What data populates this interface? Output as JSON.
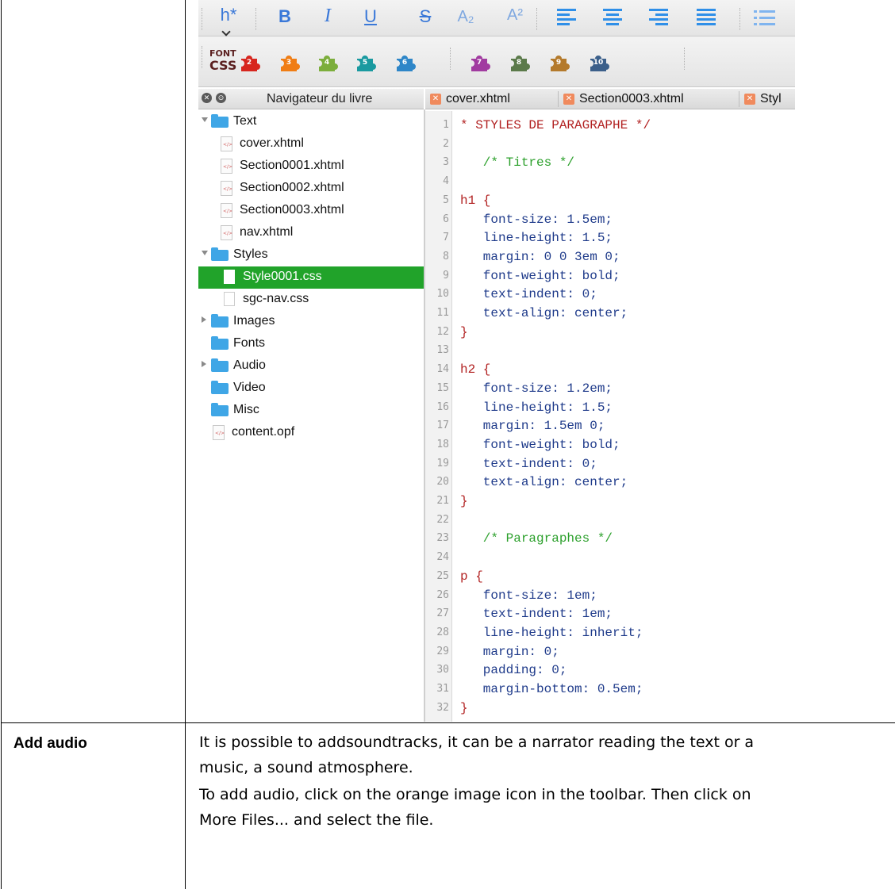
{
  "toolbar": {
    "heading_label": "h*",
    "bold": "B",
    "italic": "I",
    "underline": "U",
    "strike": "S",
    "subscript": "A₂",
    "superscript": "A²",
    "font_css_top": "FONT",
    "font_css_bottom": "CSS",
    "clip_numbers": [
      "2",
      "3",
      "4",
      "5",
      "6",
      "7",
      "8",
      "9",
      "10"
    ],
    "clip_colors": [
      "#d7261e",
      "#f07d14",
      "#7cae3c",
      "#1a9aa0",
      "#2e86c8",
      "#a13ba0",
      "#5b7a4a",
      "#b47a2c",
      "#3b5f8a"
    ]
  },
  "navigator": {
    "close_glyph": "✕",
    "float_glyph": "⊙",
    "title": "Navigateur du livre",
    "items": [
      {
        "label": "Text",
        "type": "folder",
        "expander": "down"
      },
      {
        "label": "cover.xhtml",
        "type": "file"
      },
      {
        "label": "Section0001.xhtml",
        "type": "file"
      },
      {
        "label": "Section0002.xhtml",
        "type": "file"
      },
      {
        "label": "Section0003.xhtml",
        "type": "file"
      },
      {
        "label": "nav.xhtml",
        "type": "file"
      },
      {
        "label": "Styles",
        "type": "folder",
        "expander": "down"
      },
      {
        "label": "Style0001.css",
        "type": "css",
        "selected": true
      },
      {
        "label": "sgc-nav.css",
        "type": "css"
      },
      {
        "label": "Images",
        "type": "folder",
        "expander": "right"
      },
      {
        "label": "Fonts",
        "type": "folder"
      },
      {
        "label": "Audio",
        "type": "folder",
        "expander": "right"
      },
      {
        "label": "Video",
        "type": "folder"
      },
      {
        "label": "Misc",
        "type": "folder"
      },
      {
        "label": "content.opf",
        "type": "file"
      }
    ]
  },
  "tabs": [
    {
      "label": "cover.xhtml"
    },
    {
      "label": "Section0003.xhtml"
    },
    {
      "label": "Styl"
    }
  ],
  "tab_close_glyph": "✕",
  "colors": {
    "selection": "#21a32a",
    "comment": "#2ca02c",
    "selector": "#b22222",
    "property": "#1e3a8a"
  },
  "code": {
    "lines": [
      {
        "n": "1",
        "text": "* STYLES DE PARAGRAPHE */",
        "kind": "selector"
      },
      {
        "n": "2",
        "text": "",
        "kind": "plain"
      },
      {
        "n": "3",
        "text": "   /* Titres */",
        "kind": "comment"
      },
      {
        "n": "4",
        "text": "",
        "kind": "plain"
      },
      {
        "n": "5",
        "text": "h1 {",
        "kind": "selector"
      },
      {
        "n": "6",
        "text": "   font-size: 1.5em;",
        "kind": "property"
      },
      {
        "n": "7",
        "text": "   line-height: 1.5;",
        "kind": "property"
      },
      {
        "n": "8",
        "text": "   margin: 0 0 3em 0;",
        "kind": "property"
      },
      {
        "n": "9",
        "text": "   font-weight: bold;",
        "kind": "property"
      },
      {
        "n": "10",
        "text": "   text-indent: 0;",
        "kind": "property"
      },
      {
        "n": "11",
        "text": "   text-align: center;",
        "kind": "property"
      },
      {
        "n": "12",
        "text": "}",
        "kind": "selector"
      },
      {
        "n": "13",
        "text": "",
        "kind": "plain"
      },
      {
        "n": "14",
        "text": "h2 {",
        "kind": "selector"
      },
      {
        "n": "15",
        "text": "   font-size: 1.2em;",
        "kind": "property"
      },
      {
        "n": "16",
        "text": "   line-height: 1.5;",
        "kind": "property"
      },
      {
        "n": "17",
        "text": "   margin: 1.5em 0;",
        "kind": "property"
      },
      {
        "n": "18",
        "text": "   font-weight: bold;",
        "kind": "property"
      },
      {
        "n": "19",
        "text": "   text-indent: 0;",
        "kind": "property"
      },
      {
        "n": "20",
        "text": "   text-align: center;",
        "kind": "property"
      },
      {
        "n": "21",
        "text": "}",
        "kind": "selector"
      },
      {
        "n": "22",
        "text": "",
        "kind": "plain"
      },
      {
        "n": "23",
        "text": "   /* Paragraphes */",
        "kind": "comment"
      },
      {
        "n": "24",
        "text": "",
        "kind": "plain"
      },
      {
        "n": "25",
        "text": "p {",
        "kind": "selector"
      },
      {
        "n": "26",
        "text": "   font-size: 1em;",
        "kind": "property"
      },
      {
        "n": "27",
        "text": "   text-indent: 1em;",
        "kind": "property"
      },
      {
        "n": "28",
        "text": "   line-height: inherit;",
        "kind": "property"
      },
      {
        "n": "29",
        "text": "   margin: 0;",
        "kind": "property"
      },
      {
        "n": "30",
        "text": "   padding: 0;",
        "kind": "property"
      },
      {
        "n": "31",
        "text": "   margin-bottom: 0.5em;",
        "kind": "property"
      },
      {
        "n": "32",
        "text": "}",
        "kind": "selector"
      }
    ]
  },
  "table_row": {
    "label": "Add audio",
    "lines": [
      "It is possible to addsoundtracks, it can be a narrator reading the text or a",
      "music, a sound atmosphere.",
      "To add audio, click on the orange image icon in the toolbar. Then click on",
      "More Files... and select the file."
    ]
  }
}
